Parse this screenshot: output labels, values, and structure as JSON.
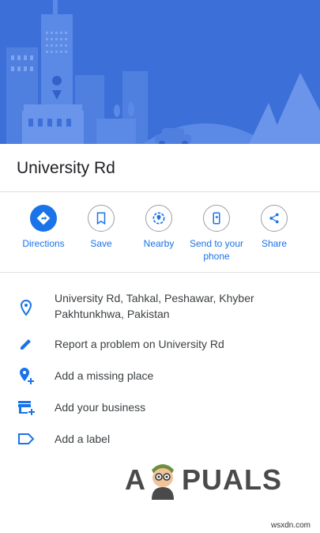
{
  "place": {
    "title": "University Rd"
  },
  "actions": [
    {
      "label": "Directions",
      "icon": "directions-icon"
    },
    {
      "label": "Save",
      "icon": "bookmark-icon"
    },
    {
      "label": "Nearby",
      "icon": "nearby-icon"
    },
    {
      "label": "Send to your phone",
      "icon": "phone-icon"
    },
    {
      "label": "Share",
      "icon": "share-icon"
    }
  ],
  "details": [
    {
      "text": "University Rd, Tahkal, Peshawar, Khyber Pakhtunkhwa, Pakistan",
      "icon": "location-pin-icon"
    },
    {
      "text": "Report a problem on University Rd",
      "icon": "pencil-icon"
    },
    {
      "text": "Add a missing place",
      "icon": "add-place-icon"
    },
    {
      "text": "Add your business",
      "icon": "add-business-icon"
    },
    {
      "text": "Add a label",
      "icon": "label-icon"
    }
  ],
  "colors": {
    "accent": "#1a73e8",
    "hero_bg": "#3d6fd9"
  },
  "watermark": {
    "left": "A",
    "right": "PUALS"
  },
  "footer": "wsxdn.com"
}
